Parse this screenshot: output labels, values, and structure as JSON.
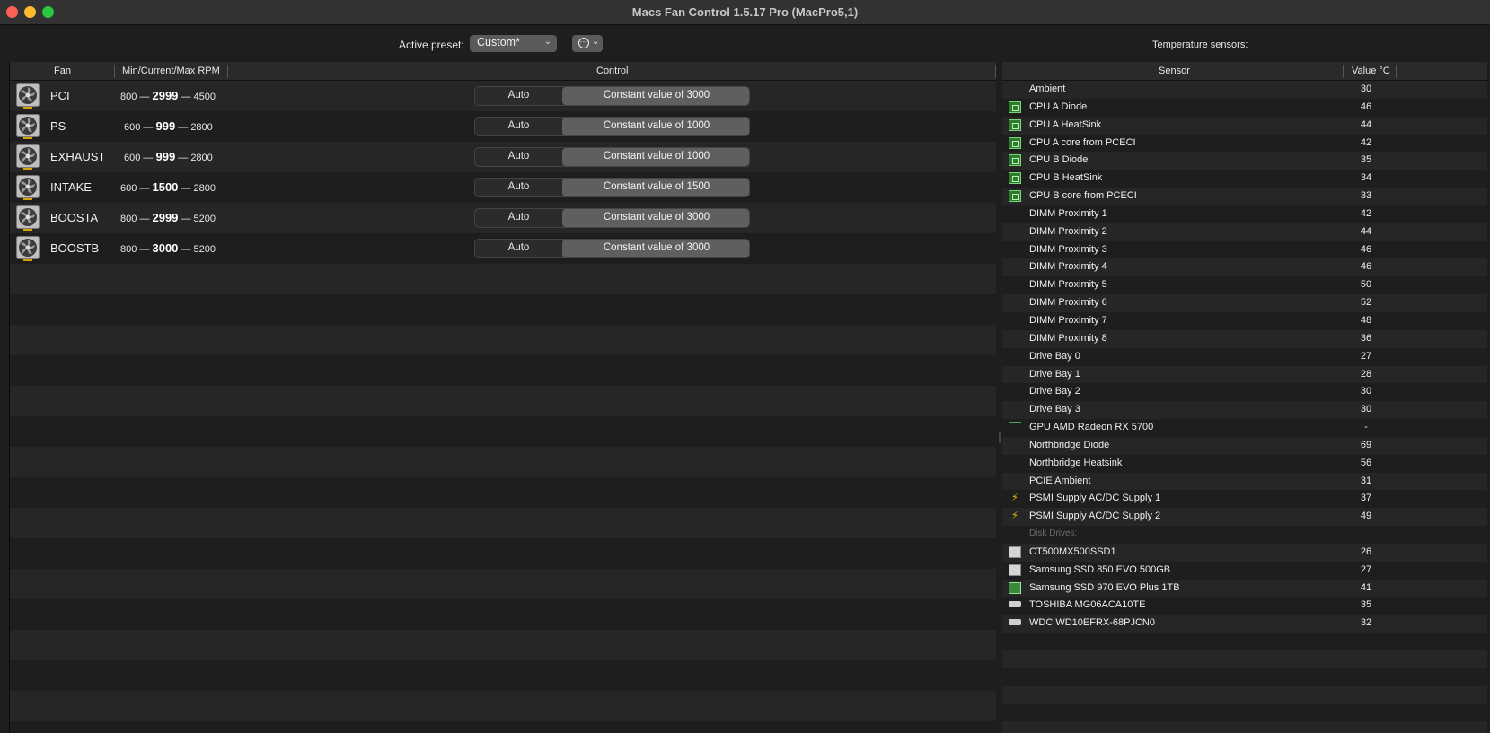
{
  "window": {
    "title": "Macs Fan Control 1.5.17 Pro (MacPro5,1)"
  },
  "toolbar": {
    "active_preset_label": "Active preset:",
    "preset_value": "Custom*",
    "temperature_sensors_label": "Temperature sensors:"
  },
  "fan_table": {
    "headers": {
      "fan": "Fan",
      "rpm": "Min/Current/Max RPM",
      "control": "Control"
    },
    "rows": [
      {
        "name": "PCI",
        "min": "800",
        "current": "2999",
        "max": "4500",
        "auto_label": "Auto",
        "constant_label": "Constant value of 3000"
      },
      {
        "name": "PS",
        "min": "600",
        "current": "999",
        "max": "2800",
        "auto_label": "Auto",
        "constant_label": "Constant value of 1000"
      },
      {
        "name": "EXHAUST",
        "min": "600",
        "current": "999",
        "max": "2800",
        "auto_label": "Auto",
        "constant_label": "Constant value of 1000"
      },
      {
        "name": "INTAKE",
        "min": "600",
        "current": "1500",
        "max": "2800",
        "auto_label": "Auto",
        "constant_label": "Constant value of 1500"
      },
      {
        "name": "BOOSTA",
        "min": "800",
        "current": "2999",
        "max": "5200",
        "auto_label": "Auto",
        "constant_label": "Constant value of 3000"
      },
      {
        "name": "BOOSTB",
        "min": "800",
        "current": "3000",
        "max": "5200",
        "auto_label": "Auto",
        "constant_label": "Constant value of 3000"
      }
    ]
  },
  "sensor_table": {
    "headers": {
      "sensor": "Sensor",
      "value": "Value °C"
    },
    "rows": [
      {
        "name": "Ambient",
        "value": "30",
        "icon": "none"
      },
      {
        "name": "CPU A Diode",
        "value": "46",
        "icon": "cpu-chip-icon"
      },
      {
        "name": "CPU A HeatSink",
        "value": "44",
        "icon": "cpu-chip-icon"
      },
      {
        "name": "CPU A core from PCECI",
        "value": "42",
        "icon": "cpu-chip-icon"
      },
      {
        "name": "CPU B Diode",
        "value": "35",
        "icon": "cpu-chip-icon"
      },
      {
        "name": "CPU B HeatSink",
        "value": "34",
        "icon": "cpu-chip-icon"
      },
      {
        "name": "CPU B core from PCECI",
        "value": "33",
        "icon": "cpu-chip-icon"
      },
      {
        "name": "DIMM Proximity 1",
        "value": "42",
        "icon": "none"
      },
      {
        "name": "DIMM Proximity 2",
        "value": "44",
        "icon": "none"
      },
      {
        "name": "DIMM Proximity 3",
        "value": "46",
        "icon": "none"
      },
      {
        "name": "DIMM Proximity 4",
        "value": "46",
        "icon": "none"
      },
      {
        "name": "DIMM Proximity 5",
        "value": "50",
        "icon": "none"
      },
      {
        "name": "DIMM Proximity 6",
        "value": "52",
        "icon": "none"
      },
      {
        "name": "DIMM Proximity 7",
        "value": "48",
        "icon": "none"
      },
      {
        "name": "DIMM Proximity 8",
        "value": "36",
        "icon": "none"
      },
      {
        "name": "Drive Bay 0",
        "value": "27",
        "icon": "none"
      },
      {
        "name": "Drive Bay 1",
        "value": "28",
        "icon": "none"
      },
      {
        "name": "Drive Bay 2",
        "value": "30",
        "icon": "none"
      },
      {
        "name": "Drive Bay 3",
        "value": "30",
        "icon": "none"
      },
      {
        "name": "GPU AMD Radeon RX 5700",
        "value": "-",
        "icon": "gpu-icon"
      },
      {
        "name": "Northbridge Diode",
        "value": "69",
        "icon": "none"
      },
      {
        "name": "Northbridge Heatsink",
        "value": "56",
        "icon": "none"
      },
      {
        "name": "PCIE Ambient",
        "value": "31",
        "icon": "none"
      },
      {
        "name": "PSMI Supply AC/DC Supply 1",
        "value": "37",
        "icon": "power-bolt-icon"
      },
      {
        "name": "PSMI Supply AC/DC Supply 2",
        "value": "49",
        "icon": "power-bolt-icon"
      },
      {
        "name": "Disk Drives:",
        "value": "",
        "icon": "none",
        "section": true
      },
      {
        "name": "CT500MX500SSD1",
        "value": "26",
        "icon": "ssd-icon"
      },
      {
        "name": "Samsung SSD 850 EVO 500GB",
        "value": "27",
        "icon": "ssd-icon"
      },
      {
        "name": "Samsung SSD 970 EVO Plus 1TB",
        "value": "41",
        "icon": "nvme-icon"
      },
      {
        "name": "TOSHIBA MG06ACA10TE",
        "value": "35",
        "icon": "hdd-icon"
      },
      {
        "name": "WDC WD10EFRX-68PJCN0",
        "value": "32",
        "icon": "hdd-icon"
      }
    ]
  },
  "colors": {
    "background": "#1e1e1e",
    "row_alt": "#262626",
    "segment_selected": "#5f5f5f",
    "close": "#fe5f57",
    "minimize": "#febc2e",
    "maximize": "#28c840"
  }
}
